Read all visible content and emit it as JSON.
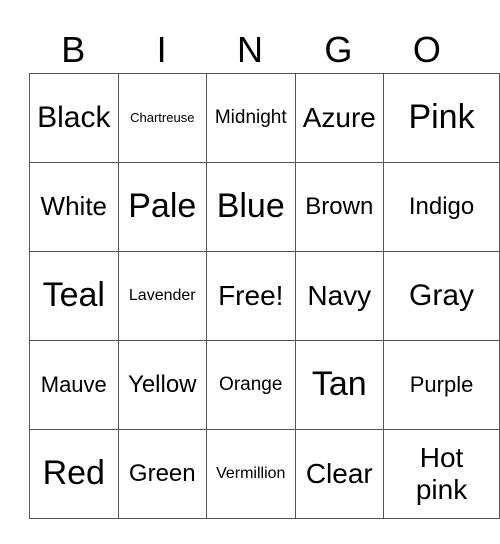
{
  "header": [
    "B",
    "I",
    "N",
    "G",
    "O"
  ],
  "rows": [
    [
      {
        "t": "Black",
        "s": 30
      },
      {
        "t": "Chartreuse",
        "s": 13
      },
      {
        "t": "Midnight",
        "s": 19
      },
      {
        "t": "Azure",
        "s": 28
      },
      {
        "t": "Pink",
        "s": 34
      }
    ],
    [
      {
        "t": "White",
        "s": 26
      },
      {
        "t": "Pale",
        "s": 34
      },
      {
        "t": "Blue",
        "s": 34
      },
      {
        "t": "Brown",
        "s": 24
      },
      {
        "t": "Indigo",
        "s": 24
      }
    ],
    [
      {
        "t": "Teal",
        "s": 34
      },
      {
        "t": "Lavender",
        "s": 16
      },
      {
        "t": "Free!",
        "s": 28
      },
      {
        "t": "Navy",
        "s": 28
      },
      {
        "t": "Gray",
        "s": 30
      }
    ],
    [
      {
        "t": "Mauve",
        "s": 22
      },
      {
        "t": "Yellow",
        "s": 24
      },
      {
        "t": "Orange",
        "s": 19
      },
      {
        "t": "Tan",
        "s": 34
      },
      {
        "t": "Purple",
        "s": 22
      }
    ],
    [
      {
        "t": "Red",
        "s": 34
      },
      {
        "t": "Green",
        "s": 24
      },
      {
        "t": "Vermillion",
        "s": 16
      },
      {
        "t": "Clear",
        "s": 28
      },
      {
        "t": "Hot pink",
        "s": 28
      }
    ]
  ]
}
